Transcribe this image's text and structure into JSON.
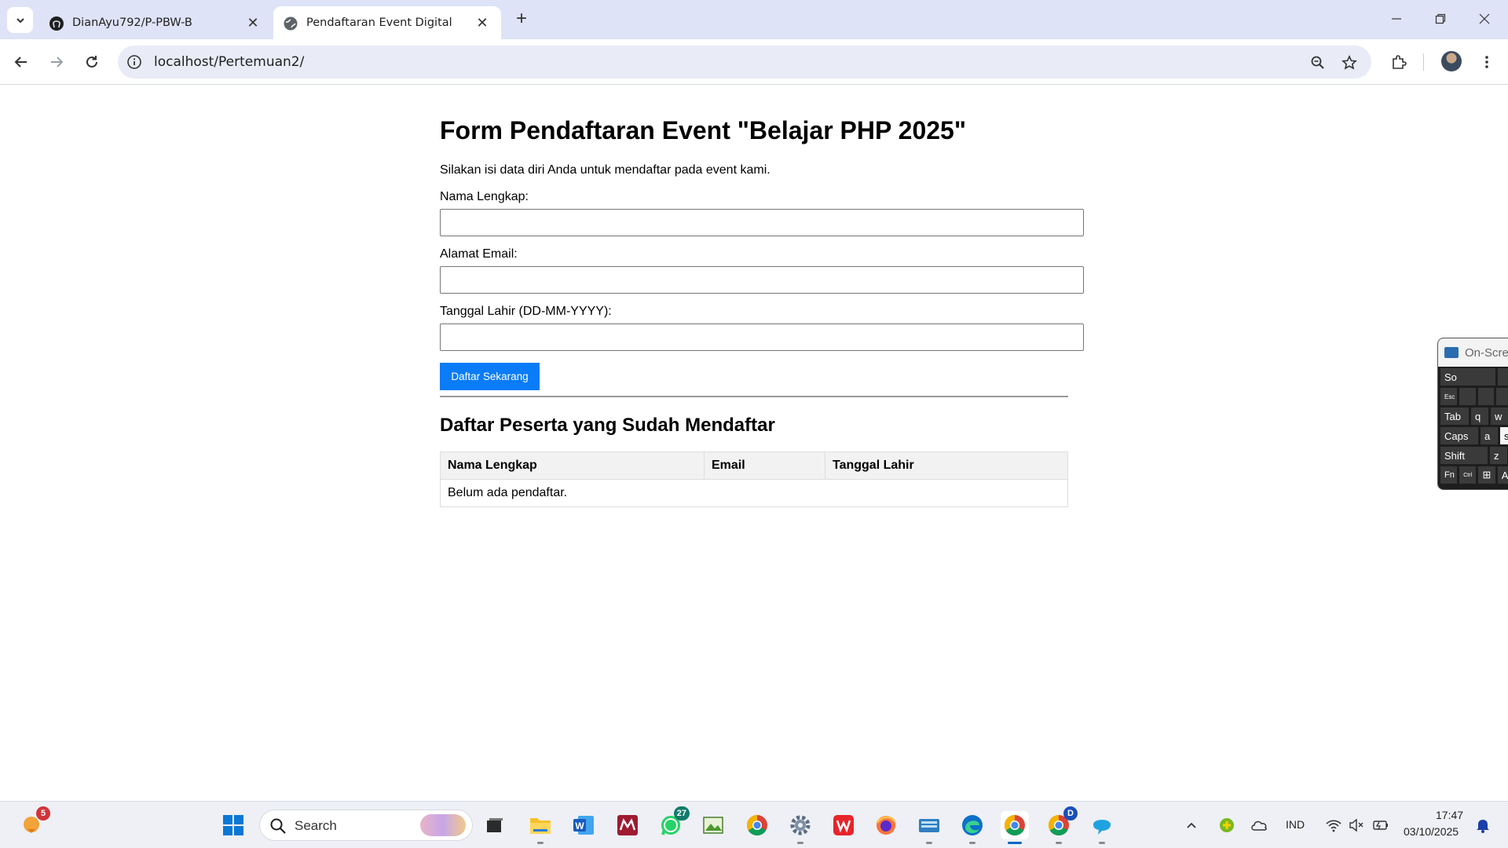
{
  "browser": {
    "tabs": [
      {
        "title": "DianAyu792/P-PBW-B",
        "active": false
      },
      {
        "title": "Pendaftaran Event Digital",
        "active": true
      }
    ],
    "url": "localhost/Pertemuan2/"
  },
  "page": {
    "title": "Form Pendaftaran Event \"Belajar PHP 2025\"",
    "intro": "Silakan isi data diri Anda untuk mendaftar pada event kami.",
    "form": {
      "name_label": "Nama Lengkap:",
      "name_value": "",
      "email_label": "Alamat Email:",
      "email_value": "",
      "dob_label": "Tanggal Lahir (DD-MM-YYYY):",
      "dob_value": "",
      "submit_label": "Daftar Sekarang"
    },
    "list_title": "Daftar Peserta yang Sudah Mendaftar",
    "table": {
      "headers": [
        "Nama Lengkap",
        "Email",
        "Tanggal Lahir"
      ],
      "empty_message": "Belum ada pendaftar."
    }
  },
  "osk": {
    "title": "On-Scre",
    "keys": [
      "So",
      "Esc",
      "Tab",
      "q",
      "w",
      "Caps",
      "a",
      "s",
      "Shift",
      "z",
      "Fn",
      "Ctrl",
      "A"
    ]
  },
  "taskbar": {
    "search_label": "Search",
    "widgets_badge": "5",
    "whatsapp_badge": "27",
    "chrome_profile_badge": "D",
    "language": "IND",
    "time": "17:47",
    "date": "03/10/2025"
  },
  "colors": {
    "accent_button": "#0a7cf7",
    "tabstrip_bg": "#dfe3f7"
  }
}
